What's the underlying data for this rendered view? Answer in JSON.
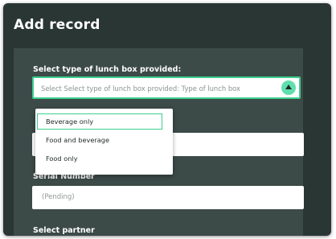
{
  "dialog": {
    "title": "Add record"
  },
  "form": {
    "lunch_box": {
      "label": "Select type of lunch box provided:",
      "placeholder": "Select Select type of lunch box provided: Type of lunch box",
      "options": [
        "Beverage only",
        "Food and beverage",
        "Food only"
      ],
      "highlighted_option": "Beverage only"
    },
    "serial_number": {
      "label": "Serial Number",
      "value": "(Pending)"
    },
    "partner": {
      "label": "Select partner"
    }
  },
  "colors": {
    "background": "#2a3634",
    "panel": "#3c4a48",
    "accent": "#3ccf8e",
    "toggle": "#5fdfae"
  },
  "icons": {
    "dropdown_toggle": "chevron-up-icon"
  }
}
